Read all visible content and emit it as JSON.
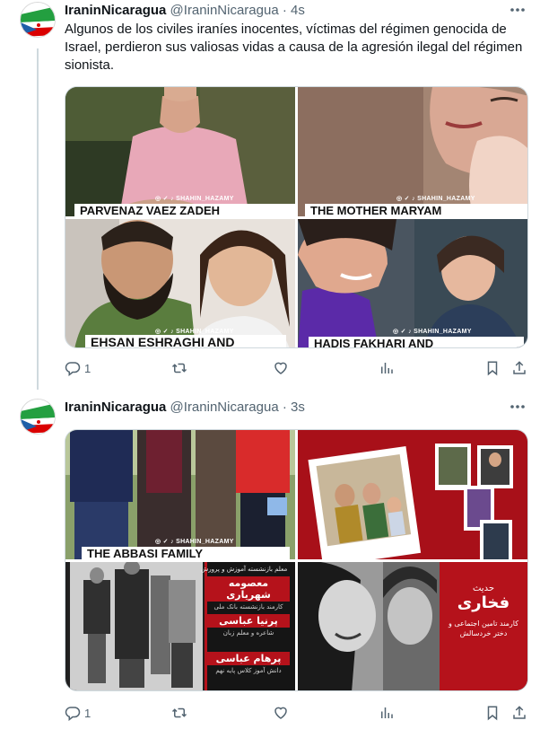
{
  "tweets": [
    {
      "display_name": "IraninNicaragua",
      "handle": "@IraninNicaragua",
      "separator": "·",
      "time": "4s",
      "text": "Algunos de los civiles iraníes inocentes, víctimas del régimen genocida de Israel, perdieron sus valiosas vidas a causa de la agresión ilegal del régimen sionista.",
      "images": [
        {
          "caption": "PARVENAZ VAEZ ZADEH",
          "watermark": "◎ ✓ ♪ SHAHIN_HAZAMY"
        },
        {
          "caption": "THE MOTHER MARYAM",
          "watermark": "◎ ✓ ♪ SHAHIN_HAZAMY"
        },
        {
          "caption": "EHSAN ESHRAGHI AND",
          "watermark": "◎ ✓ ♪ SHAHIN_HAZAMY"
        },
        {
          "caption": "HADIS FAKHARI AND",
          "watermark": "◎ ✓ ♪ SHAHIN_HAZAMY"
        }
      ],
      "replies": "1",
      "retweets": "",
      "likes": ""
    },
    {
      "display_name": "IraninNicaragua",
      "handle": "@IraninNicaragua",
      "separator": "·",
      "time": "3s",
      "images": [
        {
          "caption": "THE ABBASI FAMILY",
          "watermark": "◎ ✓ ♪ SHAHIN_HAZAMY"
        },
        {
          "caption": ""
        },
        {
          "header": "معلم بازنشسته آموزش و پرورش",
          "entries": [
            {
              "name": "معصومه شهریاری",
              "desc": "کارمند بازنشسته بانک ملی"
            },
            {
              "name": "پرنیا عباسی",
              "desc": "شاعره و معلم زبان"
            },
            {
              "name": "پرهام عباسی",
              "desc": "دانش آموز کلاس پایه نهم"
            }
          ]
        },
        {
          "label": "حدیث",
          "name": "فخاری",
          "desc": "کارمند تامین اجتماعی و دختر خردسالش"
        }
      ],
      "replies": "1",
      "retweets": "",
      "likes": ""
    }
  ],
  "icons": {
    "reply": "reply-icon",
    "retweet": "retweet-icon",
    "like": "heart-icon",
    "views": "views-icon",
    "bookmark": "bookmark-icon",
    "share": "share-icon",
    "more": "more-icon"
  },
  "colors": {
    "name": "#0f1419",
    "meta": "#536471",
    "thread_line": "#cfd9de",
    "flag_green": "#239f40",
    "flag_red": "#da0000",
    "accent_red": "#b5121b"
  }
}
